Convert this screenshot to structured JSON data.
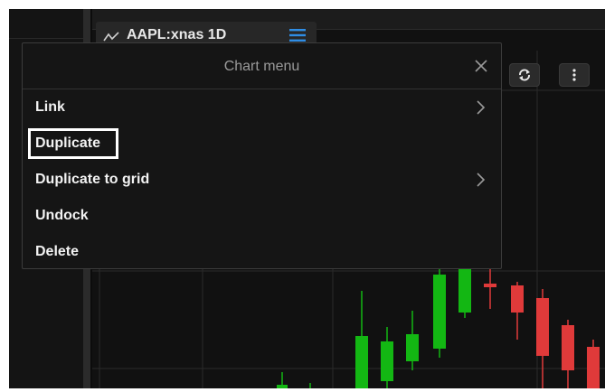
{
  "chart_tab": {
    "title": "AAPL:xnas 1D"
  },
  "chart_menu": {
    "title": "Chart menu",
    "close_icon": "close-icon",
    "items": [
      {
        "label": "Link",
        "has_submenu": true
      },
      {
        "label": "Duplicate",
        "has_submenu": false,
        "highlighted": true
      },
      {
        "label": "Duplicate to grid",
        "has_submenu": true
      },
      {
        "label": "Undock",
        "has_submenu": false
      },
      {
        "label": "Delete",
        "has_submenu": false
      }
    ]
  },
  "toolbar": {
    "buttons": [
      "refresh-icon",
      "more-vertical-icon"
    ]
  },
  "colors": {
    "up_candle": "#13b713",
    "down_candle": "#e03a3a",
    "accent_blue": "#2f8de4",
    "background": "#111111"
  }
}
